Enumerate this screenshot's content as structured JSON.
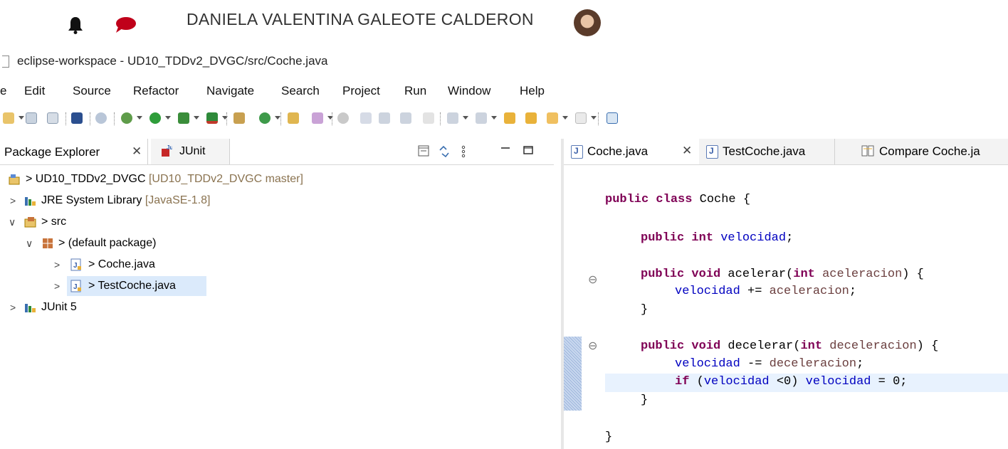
{
  "user": {
    "name": "DANIELA VALENTINA GALEOTE CALDERON"
  },
  "window": {
    "title": "eclipse-workspace - UD10_TDDv2_DVGC/src/Coche.java"
  },
  "menu": [
    "e",
    "Edit",
    "Source",
    "Refactor",
    "Navigate",
    "Search",
    "Project",
    "Run",
    "Window",
    "Help"
  ],
  "left_panel": {
    "tab_package_explorer": "Package Explorer",
    "tab_junit": "JUnit",
    "close_glyph": "✕",
    "tree": {
      "project": {
        "prefix": ">",
        "name": "UD10_TDDv2_DVGC",
        "decoration": "[UD10_TDDv2_DVGC master]"
      },
      "jre": {
        "name": "JRE System Library",
        "decoration": "[JavaSE-1.8]"
      },
      "src": {
        "prefix": ">",
        "name": "src"
      },
      "default_package": {
        "prefix": ">",
        "name": "(default package)"
      },
      "coche": {
        "prefix": ">",
        "name": "Coche.java"
      },
      "testcoche": {
        "prefix": ">",
        "name": "TestCoche.java"
      },
      "junit5": {
        "name": "JUnit 5"
      }
    }
  },
  "editor": {
    "tabs": [
      {
        "label": "Coche.java",
        "active": true
      },
      {
        "label": "TestCoche.java",
        "active": false
      },
      {
        "label": "Compare Coche.ja",
        "active": false
      }
    ],
    "close_glyph": "✕",
    "code": {
      "l1_kw": "public class",
      "l1_rest": " Coche {",
      "l2_kw": "public int",
      "l2_fld": "velocidad",
      "l2_rest": ";",
      "l3_kw": "public void",
      "l3_mid": " acelerar(",
      "l3_kw2": "int",
      "l3_prm": "aceleracion",
      "l3_rest": ") {",
      "l4_fld": "velocidad",
      "l4_mid": " += ",
      "l4_prm": "aceleracion",
      "l4_rest": ";",
      "l5": "}",
      "l6_kw": "public void",
      "l6_mid": " decelerar(",
      "l6_kw2": "int",
      "l6_prm": "deceleracion",
      "l6_rest": ") {",
      "l7_fld": "velocidad",
      "l7_mid": " -= ",
      "l7_prm": "deceleracion",
      "l7_rest": ";",
      "l8_kw": "if",
      "l8_mid": " (",
      "l8_fld": "velocidad",
      "l8_mid2": " <0) ",
      "l8_fld2": "velocidad",
      "l8_rest": " = 0;",
      "l9": "}",
      "l10": "}"
    }
  }
}
